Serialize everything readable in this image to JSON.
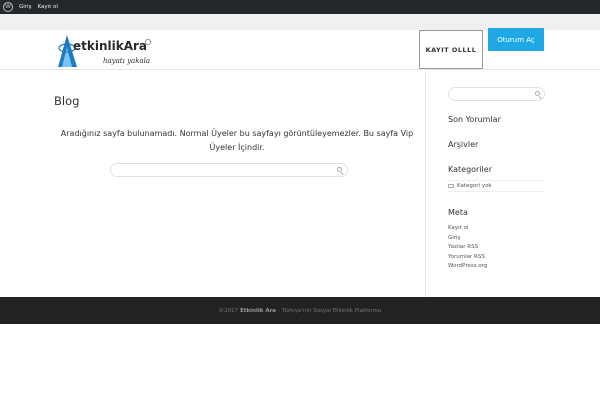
{
  "admin_bar": {
    "links": [
      "Giriş",
      "Kayıt ol"
    ]
  },
  "header": {
    "logo_main": "etkinlikAra",
    "logo_tagline": "hayatı yakala",
    "register_button": "KAYIT OLLLL",
    "login_button": "Oturum Aç"
  },
  "main": {
    "title": "Blog",
    "message": "Aradığınız sayfa bulunamadı. Normal Üyeler bu sayfayı görüntüleyemezler. Bu sayfa Vip Üyeler İçindir.",
    "search_placeholder": ""
  },
  "sidebar": {
    "search_placeholder": "",
    "recent_comments_title": "Son Yorumlar",
    "archives_title": "Arşivler",
    "categories_title": "Kategoriler",
    "category_item": "Kategori yok",
    "meta_title": "Meta",
    "meta_links": [
      "Kayıt ol",
      "Giriş",
      "Yazılar RSS",
      "Yorumlar RSS",
      "WordPress.org"
    ]
  },
  "footer": {
    "copyright": "©2017",
    "brand": "Etkinlik Ara",
    "tagline": "- Türkiye'nin Sosyal Etkinlik Platformu"
  },
  "colors": {
    "accent": "#1fa8e6",
    "admin_bar": "#23282d",
    "footer": "#222222"
  }
}
